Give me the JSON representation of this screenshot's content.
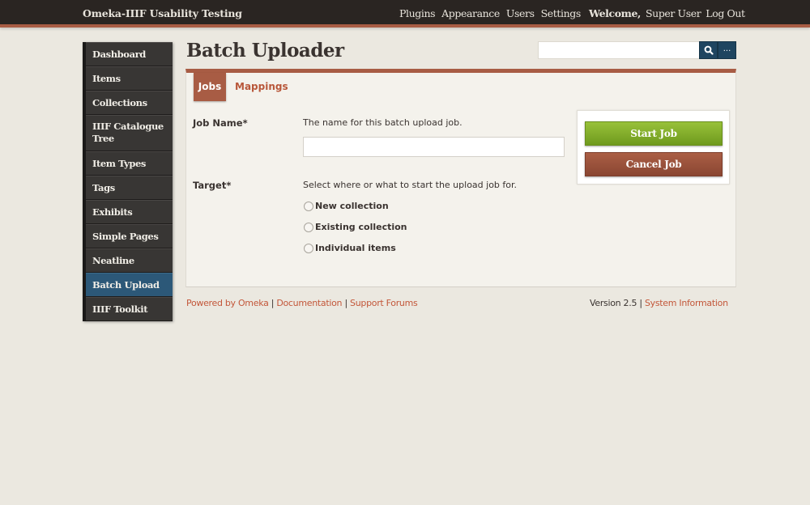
{
  "header": {
    "site_title": "Omeka-IIIF Usability Testing",
    "nav": [
      "Plugins",
      "Appearance",
      "Users",
      "Settings"
    ],
    "welcome_label": "Welcome,",
    "user_name": "Super User",
    "logout_label": "Log Out"
  },
  "sidebar": {
    "items": [
      {
        "label": "Dashboard"
      },
      {
        "label": "Items"
      },
      {
        "label": "Collections"
      },
      {
        "label": "IIIF Catalogue Tree"
      },
      {
        "label": "Item Types"
      },
      {
        "label": "Tags"
      },
      {
        "label": "Exhibits"
      },
      {
        "label": "Simple Pages"
      },
      {
        "label": "Neatline"
      },
      {
        "label": "Batch Upload",
        "active": true
      },
      {
        "label": "IIIF Toolkit"
      }
    ]
  },
  "page": {
    "title": "Batch Uploader"
  },
  "search": {
    "value": "",
    "placeholder": "",
    "advanced_label": "..."
  },
  "tabs": [
    {
      "label": "Jobs",
      "active": true
    },
    {
      "label": "Mappings",
      "active": false
    }
  ],
  "form": {
    "job_name": {
      "label": "Job Name*",
      "help": "The name for this batch upload job.",
      "value": ""
    },
    "target": {
      "label": "Target*",
      "help": "Select where or what to start the upload job for.",
      "options": [
        "New collection",
        "Existing collection",
        "Individual items"
      ],
      "selected": null
    }
  },
  "actions": {
    "start_label": "Start Job",
    "cancel_label": "Cancel Job"
  },
  "footer": {
    "powered_by": "Powered by Omeka",
    "documentation": "Documentation",
    "support_forums": "Support Forums",
    "separator": "|",
    "version": "Version 2.5",
    "system_information": "System Information"
  },
  "colors": {
    "accent": "#a85c44",
    "link": "#c3573a",
    "topbar": "#2a2522",
    "sidebar_active": "#2c5878",
    "start_button": "#7faa28",
    "cancel_button": "#9a523b"
  }
}
